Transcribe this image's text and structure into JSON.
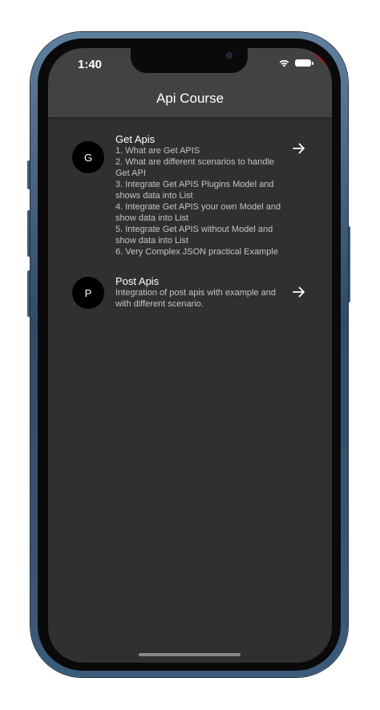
{
  "status_bar": {
    "time": "1:40",
    "icons": [
      "wifi-icon",
      "battery-icon"
    ]
  },
  "debug_banner": "DEBUG",
  "app_bar": {
    "title": "Api Course"
  },
  "list": [
    {
      "avatar": "G",
      "title": "Get Apis",
      "subtitle": "1. What are Get APIS\n2. What are different scenarios to handle Get API\n 3. Integrate Get APIS  Plugins Model and shows data into List\n 4. Integrate Get APIS  your own Model and show data into List\n 5. Integrate Get APIS  without Model and show data into List\n 6. Very Complex JSON practical Example",
      "trailing_icon": "arrow-forward-icon"
    },
    {
      "avatar": "P",
      "title": "Post Apis",
      "subtitle": "Integration of post apis with example and with different scenario.",
      "trailing_icon": "arrow-forward-icon"
    }
  ],
  "colors": {
    "app_bar": "#424242",
    "background": "#303030",
    "avatar": "#000000",
    "phone_frame": "#3b5b7a",
    "debug_ribbon": "#a3161b"
  }
}
